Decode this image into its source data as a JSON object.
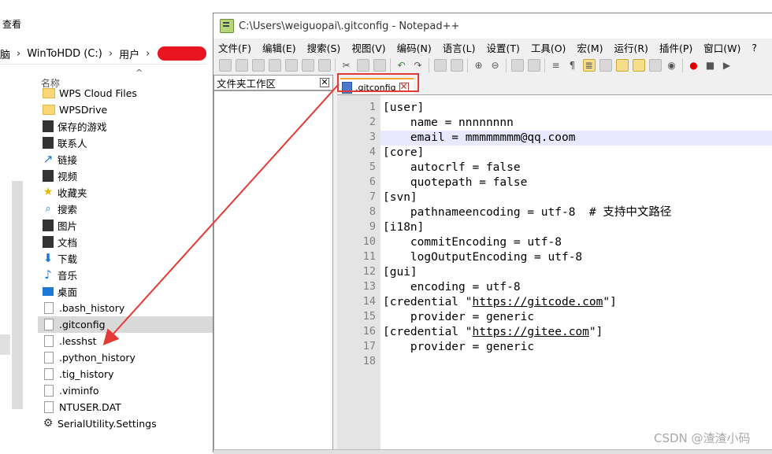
{
  "explorer": {
    "menu_view": "查看",
    "breadcrumb": {
      "part1": "脑",
      "part2": "WinToHDD (C:)",
      "part3": "用户"
    },
    "column_name": "名称",
    "files": [
      {
        "label": "WPS Cloud Files",
        "icon": "folder-icon"
      },
      {
        "label": "WPSDrive",
        "icon": "folder-icon"
      },
      {
        "label": "保存的游戏",
        "icon": "gamepad-icon"
      },
      {
        "label": "联系人",
        "icon": "contacts-icon"
      },
      {
        "label": "链接",
        "icon": "link-icon"
      },
      {
        "label": "视频",
        "icon": "video-icon"
      },
      {
        "label": "收藏夹",
        "icon": "star-icon"
      },
      {
        "label": "搜索",
        "icon": "search-icon"
      },
      {
        "label": "图片",
        "icon": "image-icon"
      },
      {
        "label": "文档",
        "icon": "document-icon"
      },
      {
        "label": "下载",
        "icon": "download-icon"
      },
      {
        "label": "音乐",
        "icon": "music-icon"
      },
      {
        "label": "桌面",
        "icon": "desktop-icon"
      },
      {
        "label": ".bash_history",
        "icon": "file-icon"
      },
      {
        "label": ".gitconfig",
        "icon": "file-icon",
        "selected": true
      },
      {
        "label": ".lesshst",
        "icon": "file-icon"
      },
      {
        "label": ".python_history",
        "icon": "file-icon"
      },
      {
        "label": ".tig_history",
        "icon": "file-icon"
      },
      {
        "label": ".viminfo",
        "icon": "file-icon"
      },
      {
        "label": "NTUSER.DAT",
        "icon": "file-icon"
      },
      {
        "label": "SerialUtility.Settings",
        "icon": "gear-icon"
      }
    ]
  },
  "notepad": {
    "title": "C:\\Users\\weiguopai\\.gitconfig - Notepad++",
    "menu": [
      "文件(F)",
      "编辑(E)",
      "搜索(S)",
      "视图(V)",
      "编码(N)",
      "语言(L)",
      "设置(T)",
      "工具(O)",
      "宏(M)",
      "运行(R)",
      "插件(P)",
      "窗口(W)",
      "?"
    ],
    "workspace_title": "文件夹工作区",
    "tab_label": ".gitconfig",
    "lines": [
      "[user]",
      "    name = nnnnnnnn",
      "    email = mmmmmmmm@qq.coom",
      "[core]",
      "    autocrlf = false",
      "    quotepath = false",
      "[svn]",
      "    pathnameencoding = utf-8  # 支持中文路径",
      "[i18n]",
      "    commitEncoding = utf-8",
      "    logOutputEncoding = utf-8",
      "[gui]",
      "    encoding = utf-8",
      "[credential \"https://gitcode.com\"]",
      "    provider = generic",
      "[credential \"https://gitee.com\"]",
      "    provider = generic",
      ""
    ],
    "line_numbers": [
      "1",
      "2",
      "3",
      "4",
      "5",
      "6",
      "7",
      "8",
      "9",
      "10",
      "11",
      "12",
      "13",
      "14",
      "15",
      "16",
      "17",
      "18"
    ],
    "current_line": 3
  },
  "watermark": "CSDN @渣渣小码",
  "colors": {
    "annotation_red": "#e53935",
    "redaction_red": "#e8141f",
    "current_line_bg": "#e8e8ff"
  }
}
